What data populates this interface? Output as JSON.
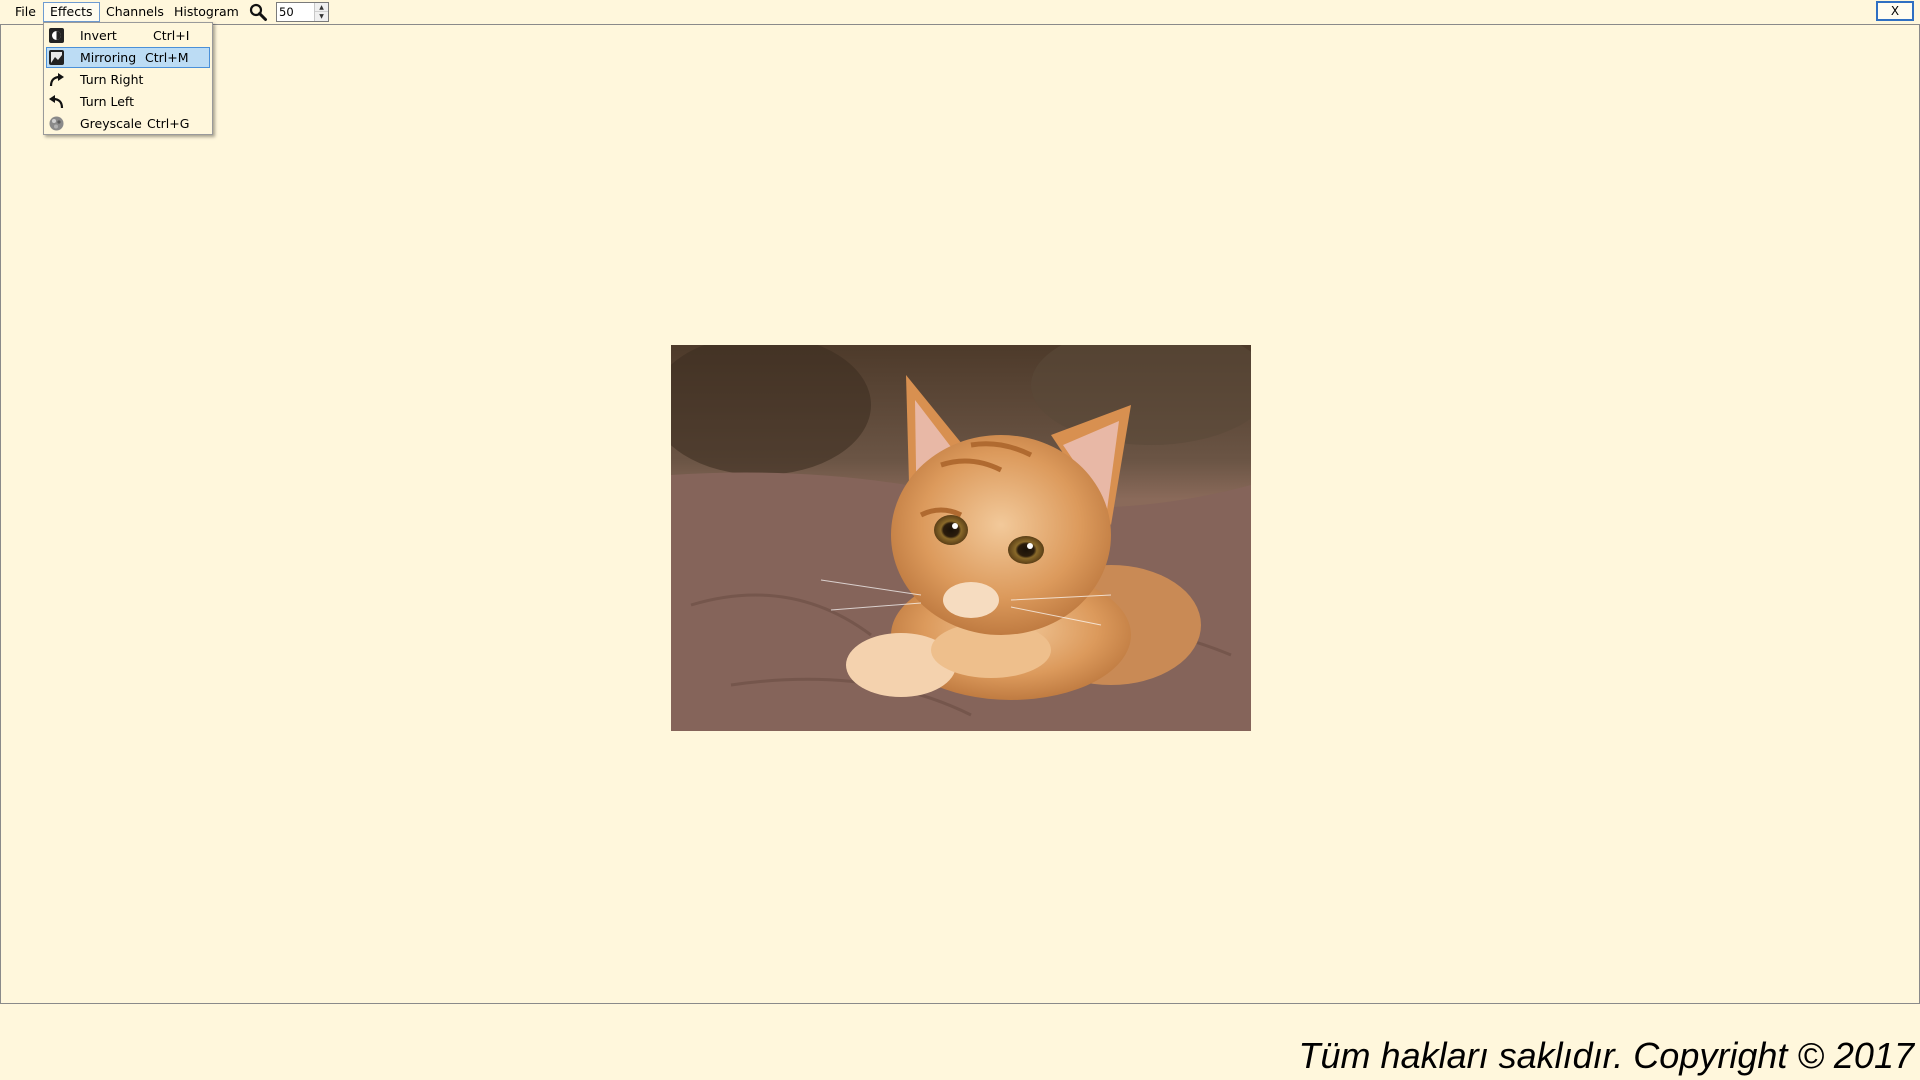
{
  "menubar": {
    "items": [
      {
        "label": "File"
      },
      {
        "label": "Effects"
      },
      {
        "label": "Channels"
      },
      {
        "label": "Histogram"
      }
    ],
    "zoom_icon": "magnifier-icon",
    "zoom_value": "50",
    "close_label": "X"
  },
  "effects_menu": {
    "items": [
      {
        "label": "Invert",
        "shortcut": "Ctrl+I",
        "icon": "invert-icon"
      },
      {
        "label": "Mirroring",
        "shortcut": "Ctrl+M",
        "icon": "mirror-icon",
        "selected": true
      },
      {
        "label": "Turn Right",
        "shortcut": "",
        "icon": "turn-right-icon"
      },
      {
        "label": "Turn Left",
        "shortcut": "",
        "icon": "turn-left-icon"
      },
      {
        "label": "Greyscale",
        "shortcut": "Ctrl+G",
        "icon": "greyscale-icon"
      }
    ]
  },
  "canvas": {
    "image": "kitten-photo"
  },
  "footer": {
    "text": "Tüm hakları saklıdır. Copyright © 2017"
  },
  "colors": {
    "background": "#FFF7DC",
    "selection": "#BCDCF4",
    "selection_border": "#4A90D9",
    "close_border": "#2F6FC2"
  }
}
